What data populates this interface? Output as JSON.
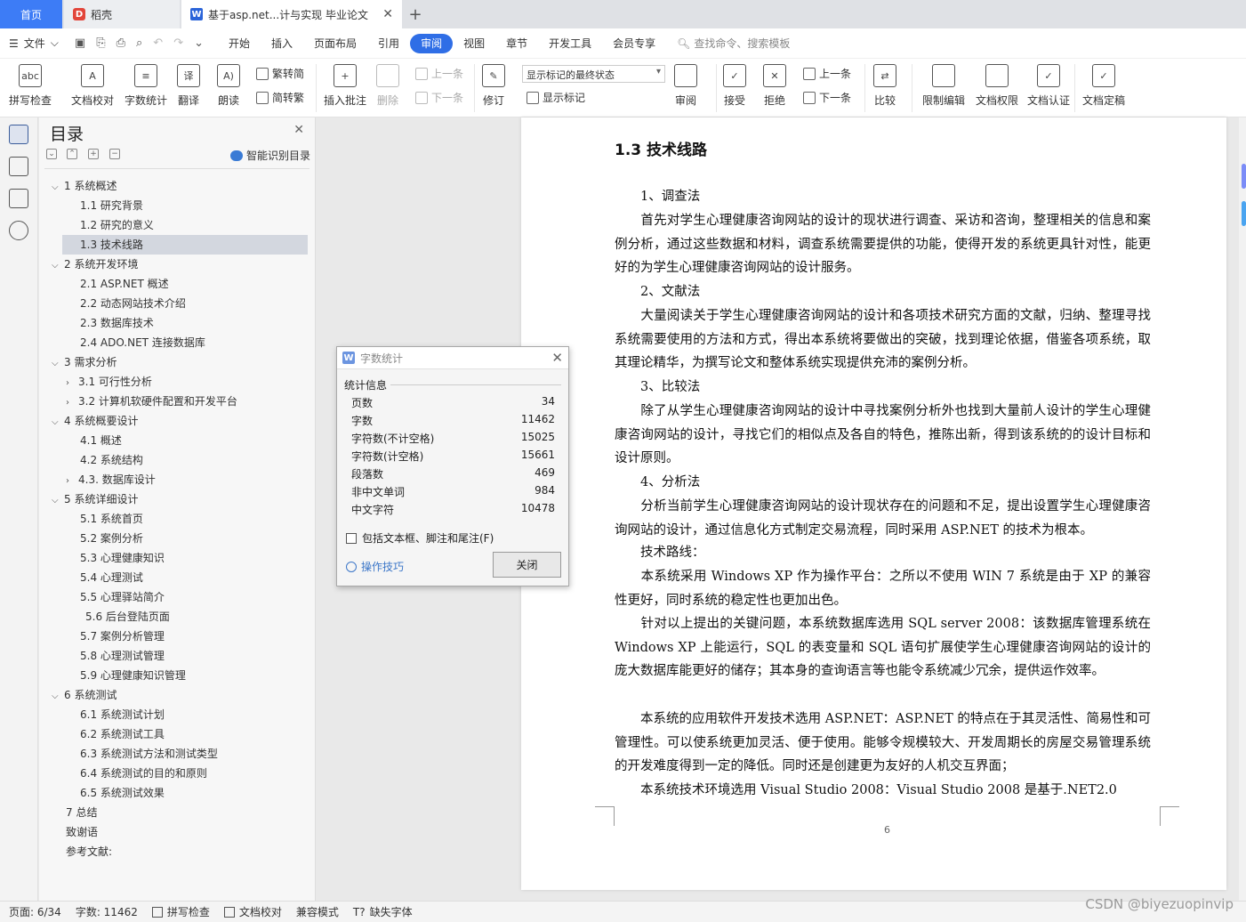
{
  "tabs": {
    "home": "首页",
    "daoke": "稻壳",
    "doc": "基于asp.net...计与实现 毕业论文",
    "add": "+"
  },
  "menubar": {
    "file": "文件",
    "items": [
      "开始",
      "插入",
      "页面布局",
      "引用",
      "审阅",
      "视图",
      "章节",
      "开发工具",
      "会员专享"
    ],
    "active": "审阅",
    "search": "查找命令、搜索模板"
  },
  "ribbon": {
    "spell_check": "拼写检查",
    "doc_proof": "文档校对",
    "word_count": "字数统计",
    "translate": "翻译",
    "read_aloud": "朗读",
    "trad_to_simp": "繁转简",
    "simp_to_trad": "简转繁",
    "insert_comment": "插入批注",
    "delete": "删除",
    "prev": "上一条",
    "next": "下一条",
    "track": "修订",
    "markup_select": "显示标记的最终状态",
    "show_markup": "显示标记",
    "review": "审阅",
    "accept": "接受",
    "reject": "拒绝",
    "prev2": "上一条",
    "next2": "下一条",
    "compare": "比较",
    "restrict_edit": "限制编辑",
    "doc_permission": "文档权限",
    "doc_cert": "文档认证",
    "doc_finalize": "文档定稿"
  },
  "toc": {
    "title": "目录",
    "smart": "智能识别目录",
    "items": [
      {
        "label": "1  系统概述",
        "level": 1,
        "arrow": "v"
      },
      {
        "label": "1.1  研究背景",
        "level": 2,
        "arrow": ""
      },
      {
        "label": "1.2 研究的意义",
        "level": 2,
        "arrow": ""
      },
      {
        "label": "1.3 技术线路",
        "level": 2,
        "arrow": "",
        "selected": true
      },
      {
        "label": "2  系统开发环境",
        "level": 1,
        "arrow": "v"
      },
      {
        "label": "2.1 ASP.NET 概述",
        "level": 2,
        "arrow": ""
      },
      {
        "label": "2.2 动态网站技术介绍",
        "level": 2,
        "arrow": ""
      },
      {
        "label": "2.3  数据库技术",
        "level": 2,
        "arrow": ""
      },
      {
        "label": "2.4    ADO.NET 连接数据库",
        "level": 2,
        "arrow": ""
      },
      {
        "label": "3  需求分析",
        "level": 1,
        "arrow": "v"
      },
      {
        "label": "3.1 可行性分析",
        "level": 2,
        "arrow": ">"
      },
      {
        "label": "3.2 计算机软硬件配置和开发平台",
        "level": 2,
        "arrow": ">"
      },
      {
        "label": "4 系统概要设计",
        "level": 1,
        "arrow": "v"
      },
      {
        "label": "4.1  概述",
        "level": 2,
        "arrow": ""
      },
      {
        "label": "4.2  系统结构",
        "level": 2,
        "arrow": ""
      },
      {
        "label": "4.3.  数据库设计",
        "level": 2,
        "arrow": ">"
      },
      {
        "label": "5 系统详细设计",
        "level": 1,
        "arrow": "v"
      },
      {
        "label": "5.1  系统首页",
        "level": 2,
        "arrow": ""
      },
      {
        "label": "5.2 案例分析",
        "level": 2,
        "arrow": ""
      },
      {
        "label": "5.3 心理健康知识",
        "level": 2,
        "arrow": ""
      },
      {
        "label": "5.4 心理测试",
        "level": 2,
        "arrow": ""
      },
      {
        "label": "5.5 心理驿站简介",
        "level": 2,
        "arrow": ""
      },
      {
        "label": "5.6 后台登陆页面",
        "level": 3,
        "arrow": ""
      },
      {
        "label": "5.7 案例分析管理",
        "level": 2,
        "arrow": ""
      },
      {
        "label": "5.8 心理测试管理",
        "level": 2,
        "arrow": ""
      },
      {
        "label": "5.9 心理健康知识管理",
        "level": 2,
        "arrow": ""
      },
      {
        "label": "6 系统测试",
        "level": 1,
        "arrow": "v"
      },
      {
        "label": "6.1 系统测试计划",
        "level": 2,
        "arrow": ""
      },
      {
        "label": "6.2  系统测试工具",
        "level": 2,
        "arrow": ""
      },
      {
        "label": "6.3 系统测试方法和测试类型",
        "level": 2,
        "arrow": ""
      },
      {
        "label": "6.4 系统测试的目的和原则",
        "level": 2,
        "arrow": ""
      },
      {
        "label": "6.5 系统测试效果",
        "level": 2,
        "arrow": ""
      },
      {
        "label": "7  总结",
        "level": 1,
        "arrow": ""
      },
      {
        "label": "致谢语",
        "level": 1,
        "arrow": ""
      },
      {
        "label": "参考文献:",
        "level": 1,
        "arrow": ""
      }
    ]
  },
  "document": {
    "heading": "1.3 技术线路",
    "paragraphs": [
      "　　1、调查法",
      "　　首先对学生心理健康咨询网站的设计的现状进行调查、采访和咨询，整理相关的信息和案例分析，通过这些数据和材料，调查系统需要提供的功能，使得开发的系统更具针对性，能更好的为学生心理健康咨询网站的设计服务。",
      "　　2、文献法",
      "　　大量阅读关于学生心理健康咨询网站的设计和各项技术研究方面的文献，归纳、整理寻找系统需要使用的方法和方式，得出本系统将要做出的突破，找到理论依据，借鉴各项系统，取其理论精华，为撰写论文和整体系统实现提供充沛的案例分析。",
      "　　3、比较法",
      "　　除了从学生心理健康咨询网站的设计中寻找案例分析外也找到大量前人设计的学生心理健康咨询网站的设计，寻找它们的相似点及各自的特色，推陈出新，得到该系统的的设计目标和设计原则。",
      "　　4、分析法",
      "　　分析当前学生心理健康咨询网站的设计现状存在的问题和不足，提出设置学生心理健康咨询网站的设计，通过信息化方式制定交易流程，同时采用 ASP.NET 的技术为根本。",
      "　　技术路线：",
      "　　本系统采用 Windows XP 作为操作平台：之所以不使用 WIN 7 系统是由于 XP 的兼容性更好，同时系统的稳定性也更加出色。",
      "　　针对以上提出的关键问题，本系统数据库选用 SQL server 2008：该数据库管理系统在 Windows XP 上能运行，SQL 的表变量和 SQL 语句扩展使学生心理健康咨询网站的设计的庞大数据库能更好的储存；其本身的查询语言等也能令系统减少冗余，提供运作效率。",
      "　　本系统的应用软件开发技术选用 ASP.NET：ASP.NET 的特点在于其灵活性、简易性和可管理性。可以使系统更加灵活、便于使用。能够令规模较大、开发周期长的房屋交易管理系统的开发难度得到一定的降低。同时还是创建更为友好的人机交互界面；",
      "　　本系统技术环境选用 Visual Studio 2008：Visual Studio 2008 是基于.NET2.0"
    ],
    "page_number": "6"
  },
  "dialog": {
    "title": "字数统计",
    "section": "统计信息",
    "rows": [
      {
        "label": "页数",
        "value": "34"
      },
      {
        "label": "字数",
        "value": "11462"
      },
      {
        "label": "字符数(不计空格)",
        "value": "15025"
      },
      {
        "label": "字符数(计空格)",
        "value": "15661"
      },
      {
        "label": "段落数",
        "value": "469"
      },
      {
        "label": "非中文单词",
        "value": "984"
      },
      {
        "label": "中文字符",
        "value": "10478"
      }
    ],
    "checkbox": "包括文本框、脚注和尾注(F)",
    "tips": "操作技巧",
    "close": "关闭"
  },
  "statusbar": {
    "page": "页面: 6/34",
    "words": "字数: 11462",
    "spell": "拼写检查",
    "proof": "文档校对",
    "compat": "兼容模式",
    "missing_font": "缺失字体"
  },
  "watermark": "CSDN @biyezuopinvip",
  "colors": {
    "accent": "#2f6ee6",
    "home_tab": "#3d7cf6",
    "link": "#3b76c8"
  }
}
